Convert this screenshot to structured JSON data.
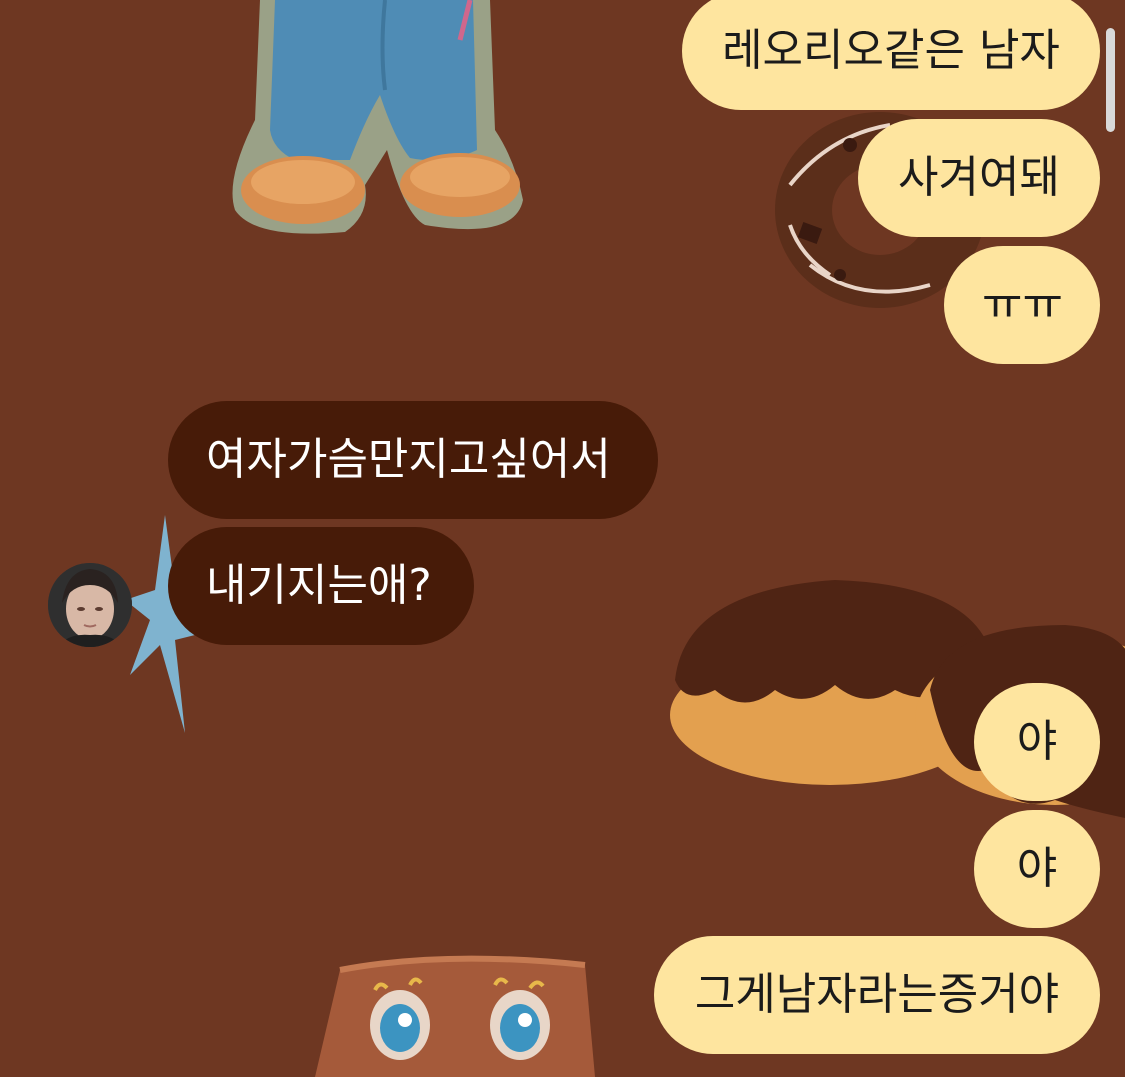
{
  "chat": {
    "background_color": "#6e3722",
    "sent_bubble_color": "#fee59f",
    "received_bubble_color": "#471b08",
    "messages": [
      {
        "from": "me",
        "text": "레오리오같은 남자"
      },
      {
        "from": "me",
        "text": "사겨여돼"
      },
      {
        "from": "me",
        "text": "ㅠㅠ"
      },
      {
        "from": "them",
        "text": "여자가슴만지고싶어서"
      },
      {
        "from": "them",
        "text": "내기지는애?"
      },
      {
        "from": "me",
        "text": "야"
      },
      {
        "from": "me",
        "text": "야"
      },
      {
        "from": "me",
        "text": "그게남자라는증거야"
      }
    ]
  },
  "wallpaper": {
    "decorations": [
      "bear-legs-sticker",
      "glazed-donut",
      "chocolate-donuts",
      "blue-star-sticker",
      "cake-face-sticker"
    ]
  },
  "sender": {
    "avatar_icon": "user-avatar"
  }
}
